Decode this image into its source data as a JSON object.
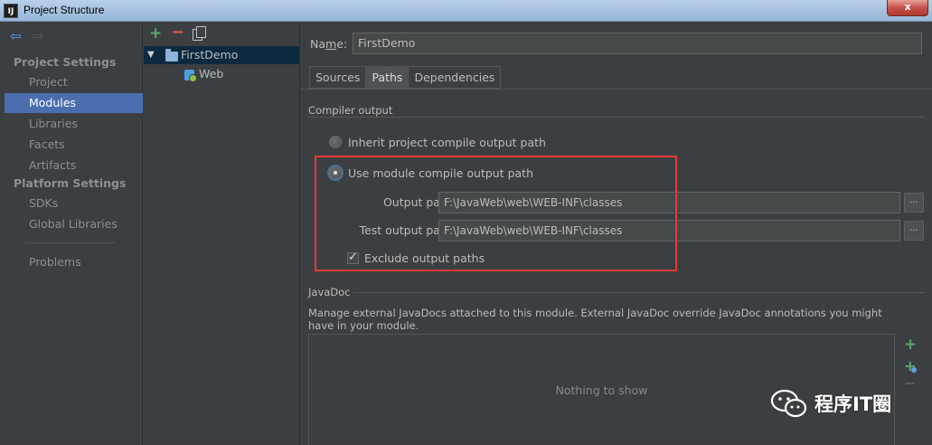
{
  "window": {
    "title": "Project Structure",
    "app_icon": "IJ"
  },
  "sidebar": {
    "project_settings_heading": "Project Settings",
    "project_items": [
      "Project",
      "Modules",
      "Libraries",
      "Facets",
      "Artifacts"
    ],
    "selected": "Modules",
    "platform_settings_heading": "Platform Settings",
    "platform_items": [
      "SDKs",
      "Global Libraries"
    ],
    "problems": "Problems"
  },
  "tree": {
    "root": "FirstDemo",
    "child": "Web"
  },
  "module": {
    "name_label_prefix": "Na",
    "name_label_mnemonic": "m",
    "name_label_suffix": "e:",
    "name_value": "FirstDemo",
    "tabs": [
      "Sources",
      "Paths",
      "Dependencies"
    ],
    "active_tab": "Paths"
  },
  "compiler_output": {
    "group_label": "Compiler output",
    "inherit_option": "Inherit project compile output path",
    "module_option": "Use module compile output path",
    "output_path_label": "Output path:",
    "output_path_value": "F:\\JavaWeb\\web\\WEB-INF\\classes",
    "test_output_path_label": "Test output path:",
    "test_output_path_value": "F:\\JavaWeb\\web\\WEB-INF\\classes",
    "browse_label": "...",
    "exclude_label": "Exclude output paths",
    "exclude_checked": true
  },
  "javadoc": {
    "group_label": "JavaDoc",
    "description": "Manage external JavaDocs attached to this module. External JavaDoc override JavaDoc annotations you might have in your module.",
    "empty_text": "Nothing to show"
  },
  "watermark": {
    "text": "程序IT圈"
  },
  "colors": {
    "selection": "#4b6eaf",
    "highlight_box": "#e53935",
    "add_green": "#59a869",
    "remove_red": "#e05555"
  }
}
